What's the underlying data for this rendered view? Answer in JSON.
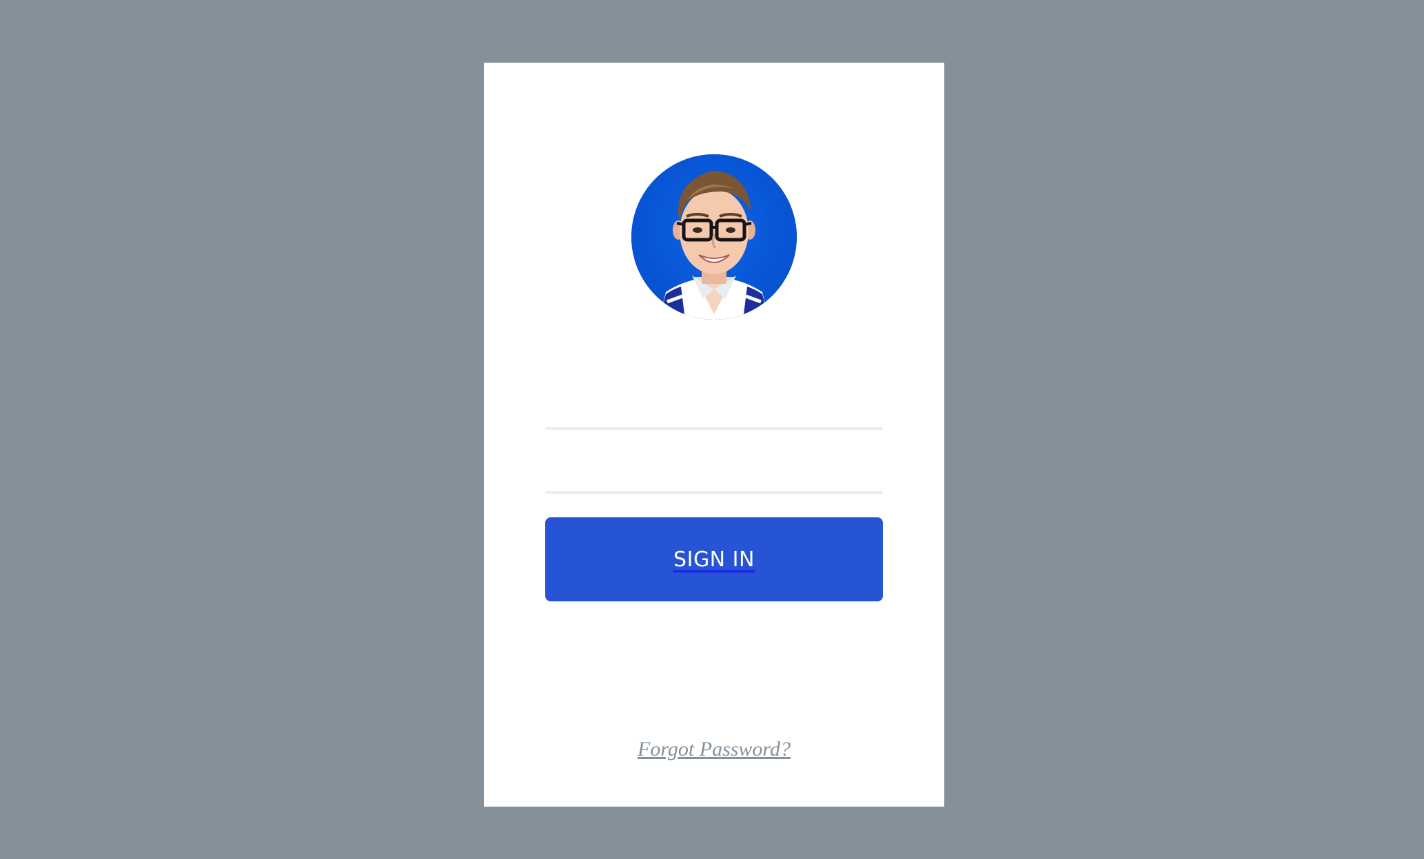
{
  "login": {
    "avatar_icon": "user-photo-avatar",
    "username_placeholder": "",
    "password_placeholder": "",
    "signin_label": "SIGN IN",
    "forgot_password_label": "Forgot Password?"
  },
  "colors": {
    "background": "#85919a",
    "card": "#ffffff",
    "accent": "#2654d5",
    "avatar_background": "#0b58d6",
    "field_underline": "#eeeeee",
    "link": "#85919a"
  }
}
